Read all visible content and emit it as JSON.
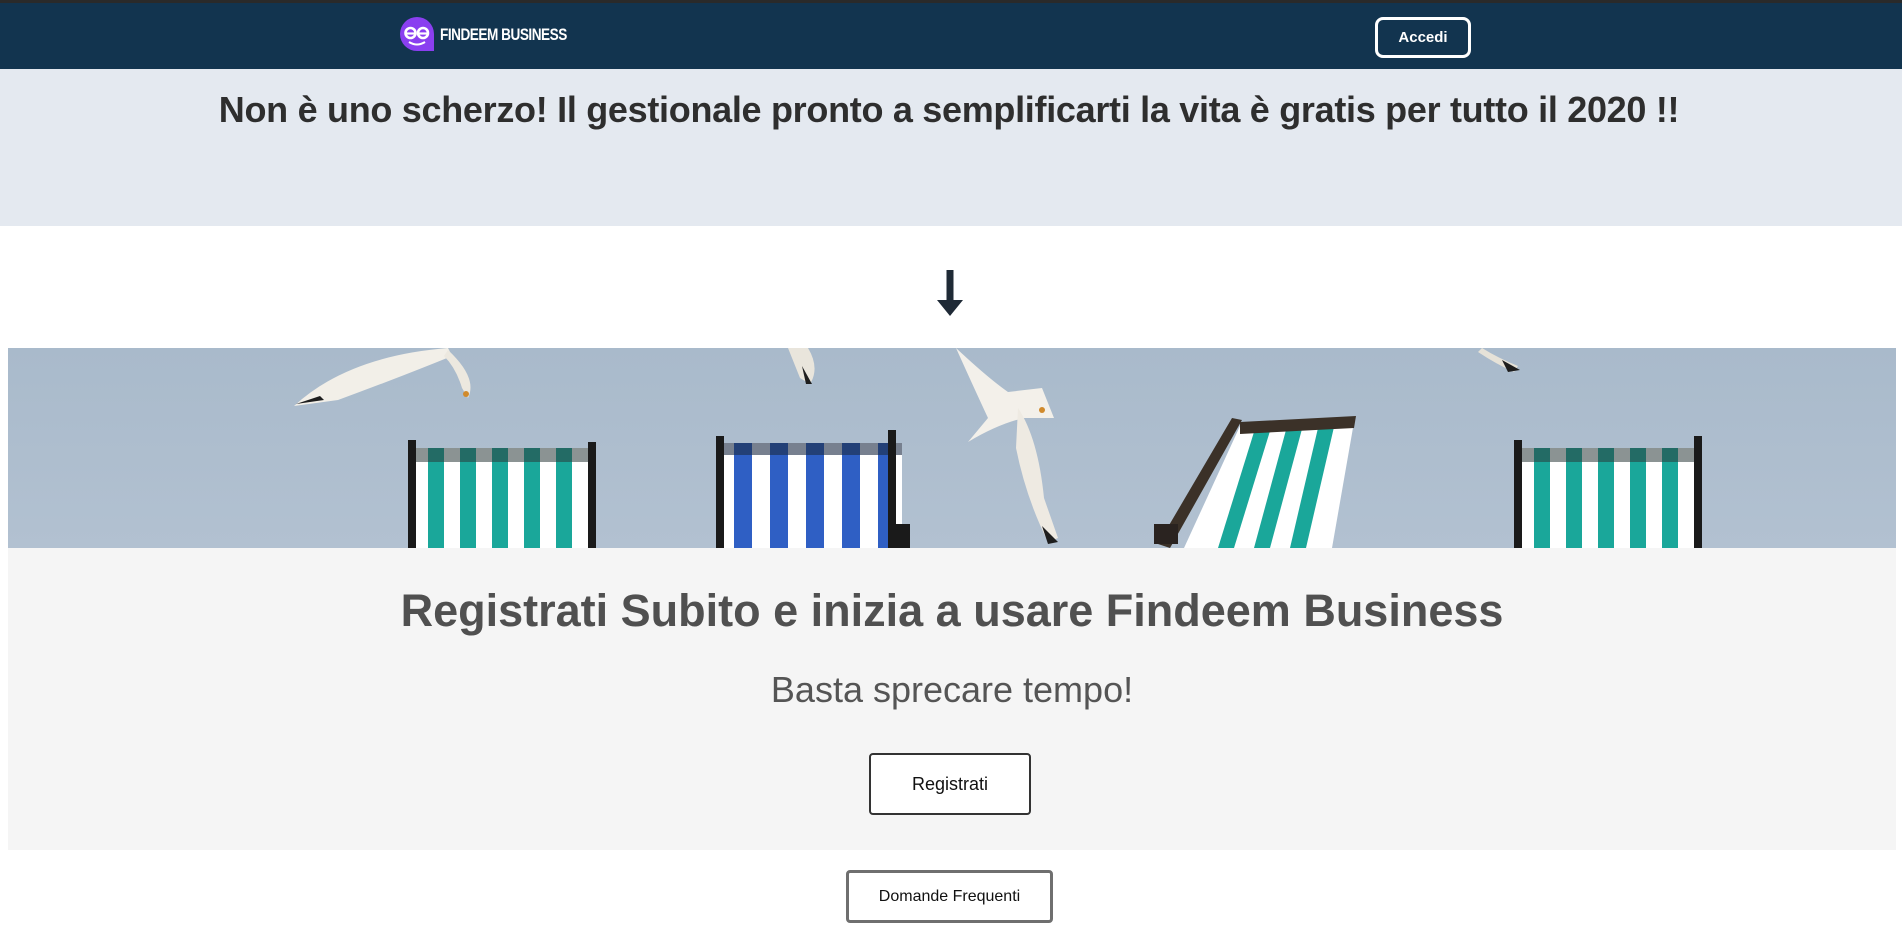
{
  "navbar": {
    "brand": "FINDEEM BUSINESS",
    "login_label": "Accedi",
    "background": "#12344f"
  },
  "promo": {
    "text": "Non è uno scherzo! Il gestionale pronto a semplificarti la vita è gratis per tutto il 2020 !!"
  },
  "signup": {
    "title": "Registrati Subito e inizia a usare Findeem Business",
    "subtitle": "Basta sprecare tempo!",
    "register_label": "Registrati"
  },
  "faq": {
    "label": "Domande Frequenti"
  },
  "icons": {
    "arrow": "arrow-down-icon",
    "logo": "findeem-logo-icon"
  },
  "colors": {
    "accent_purple": "#8a3ff0",
    "promo_bg": "#e4e9f0",
    "signup_bg": "#f5f5f5"
  }
}
